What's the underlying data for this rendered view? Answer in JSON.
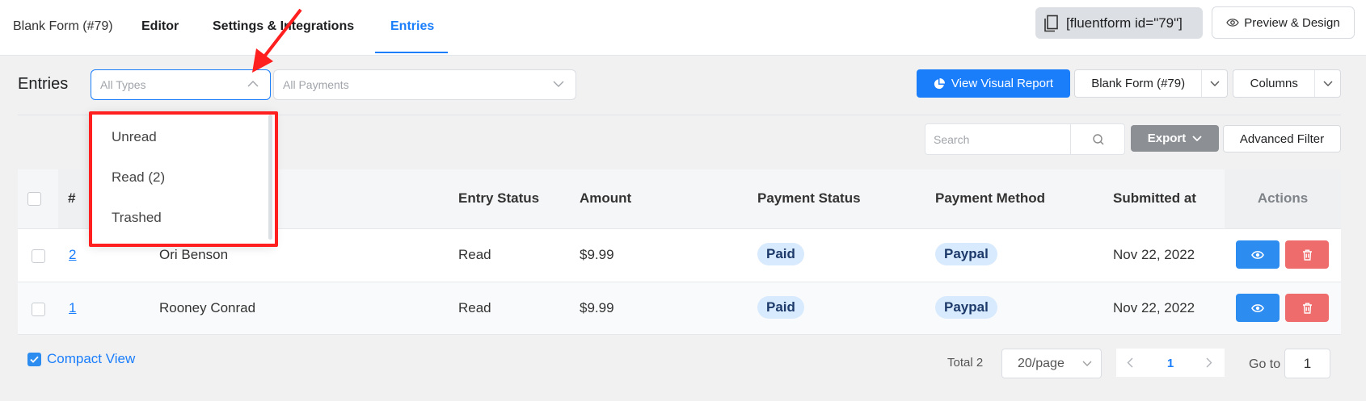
{
  "topnav": {
    "form_name": "Blank Form (#79)",
    "editor": "Editor",
    "settings": "Settings & Integrations",
    "entries": "Entries",
    "shortcode": "[fluentform id=\"79\"]",
    "preview": "Preview & Design"
  },
  "toolbar": {
    "title": "Entries",
    "types_placeholder": "All Types",
    "payments_placeholder": "All Payments",
    "visual_report": "View Visual Report",
    "form_select": "Blank Form (#79)",
    "columns": "Columns",
    "search_placeholder": "Search",
    "export": "Export",
    "advanced_filter": "Advanced Filter"
  },
  "dropdown": {
    "options": [
      "Unread",
      "Read (2)",
      "Trashed"
    ]
  },
  "table": {
    "headers": {
      "num": "#",
      "entry_status": "Entry Status",
      "amount": "Amount",
      "payment_status": "Payment Status",
      "payment_method": "Payment Method",
      "submitted_at": "Submitted at",
      "actions": "Actions"
    },
    "rows": [
      {
        "id": "2",
        "name": "Ori Benson",
        "status": "Read",
        "amount": "$9.99",
        "payment_status": "Paid",
        "payment_method": "Paypal",
        "submitted": "Nov 22, 2022"
      },
      {
        "id": "1",
        "name": "Rooney Conrad",
        "status": "Read",
        "amount": "$9.99",
        "payment_status": "Paid",
        "payment_method": "Paypal",
        "submitted": "Nov 22, 2022"
      }
    ]
  },
  "footer": {
    "compact_view": "Compact View",
    "total": "Total 2",
    "per_page": "20/page",
    "current_page": "1",
    "goto_label": "Go to",
    "goto_value": "1"
  },
  "colors": {
    "accent": "#1a7efb",
    "delete": "#ef6c6c",
    "highlight": "#ff1f1f"
  }
}
